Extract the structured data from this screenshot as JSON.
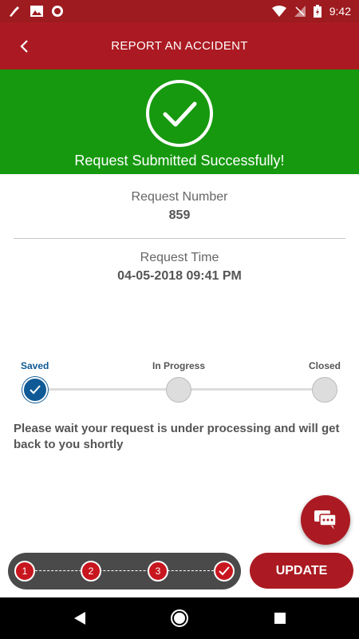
{
  "status_bar": {
    "time": "9:42",
    "icons": [
      "cleaner-icon",
      "image-icon",
      "record-icon",
      "wifi-icon",
      "no-sim-icon",
      "battery-charging-icon"
    ]
  },
  "header": {
    "title": "REPORT AN ACCIDENT",
    "back_icon": "chevron-left-icon"
  },
  "banner": {
    "message": "Request Submitted Successfully!",
    "icon": "check-circle-icon",
    "color": "#16990f"
  },
  "request": {
    "number_label": "Request Number",
    "number_value": "859",
    "time_label": "Request Time",
    "time_value": "04-05-2018 09:41 PM"
  },
  "progress": {
    "steps": [
      {
        "label": "Saved",
        "done": true
      },
      {
        "label": "In Progress",
        "done": false
      },
      {
        "label": "Closed",
        "done": false
      }
    ],
    "active_color": "#0f5a96"
  },
  "message": "Please wait your request is under processing and will get back to you shortly",
  "bottom": {
    "steps": [
      "1",
      "2",
      "3"
    ],
    "final_icon": "check-icon",
    "update_label": "UPDATE",
    "chat_icon": "chat-icon"
  },
  "colors": {
    "brand": "#ab1a22",
    "success": "#16990f"
  }
}
